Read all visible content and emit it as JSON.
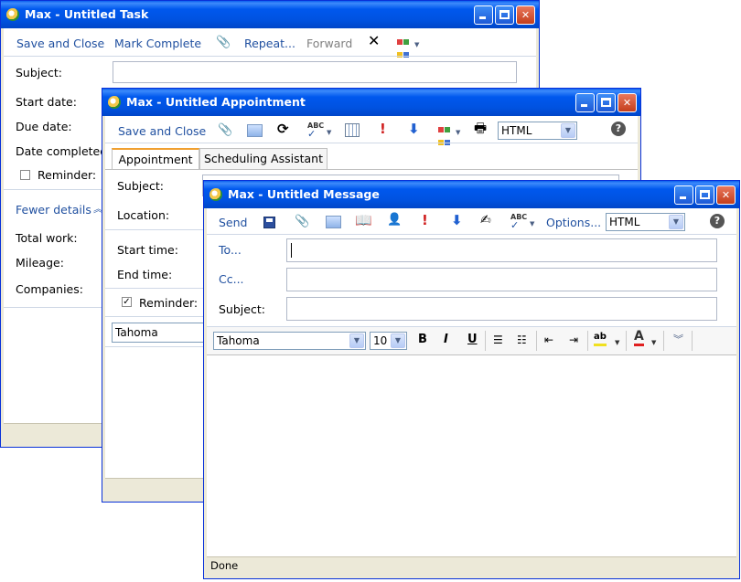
{
  "task": {
    "title": "Max - Untitled Task",
    "toolbar": {
      "save_close": "Save and Close",
      "mark_complete": "Mark Complete",
      "repeat": "Repeat...",
      "forward": "Forward"
    },
    "fields": {
      "subject": "Subject:",
      "start_date": "Start date:",
      "due_date": "Due date:",
      "date_completed": "Date completed:",
      "reminder": "Reminder:"
    },
    "fewer_details": "Fewer details",
    "details": {
      "total_work": "Total work:",
      "mileage": "Mileage:",
      "companies": "Companies:"
    }
  },
  "appointment": {
    "title": "Max - Untitled Appointment",
    "toolbar": {
      "save_close": "Save and Close",
      "format": "HTML"
    },
    "tabs": [
      "Appointment",
      "Scheduling Assistant"
    ],
    "fields": {
      "subject": "Subject:",
      "location": "Location:",
      "start_time": "Start time:",
      "end_time": "End time:",
      "reminder": "Reminder:"
    },
    "font": "Tahoma"
  },
  "message": {
    "title": "Max - Untitled Message",
    "toolbar": {
      "send": "Send",
      "options": "Options...",
      "format": "HTML"
    },
    "fields": {
      "to": "To...",
      "cc": "Cc...",
      "subject": "Subject:"
    },
    "formatting": {
      "font": "Tahoma",
      "size": "10",
      "bold": "B",
      "italic": "I",
      "underline": "U"
    },
    "status": "Done"
  },
  "colors": {
    "titlebar": "#0054E3",
    "link": "#2050a0",
    "chrome": "#ECE9D8"
  },
  "icons": [
    "paperclip-icon",
    "picture-icon",
    "refresh-icon",
    "spellcheck-icon",
    "calendar-icon",
    "importance-high-icon",
    "importance-low-icon",
    "categorize-icon",
    "print-icon",
    "help-icon",
    "save-icon",
    "address-book-icon",
    "check-names-icon",
    "signature-icon",
    "delete-icon"
  ]
}
